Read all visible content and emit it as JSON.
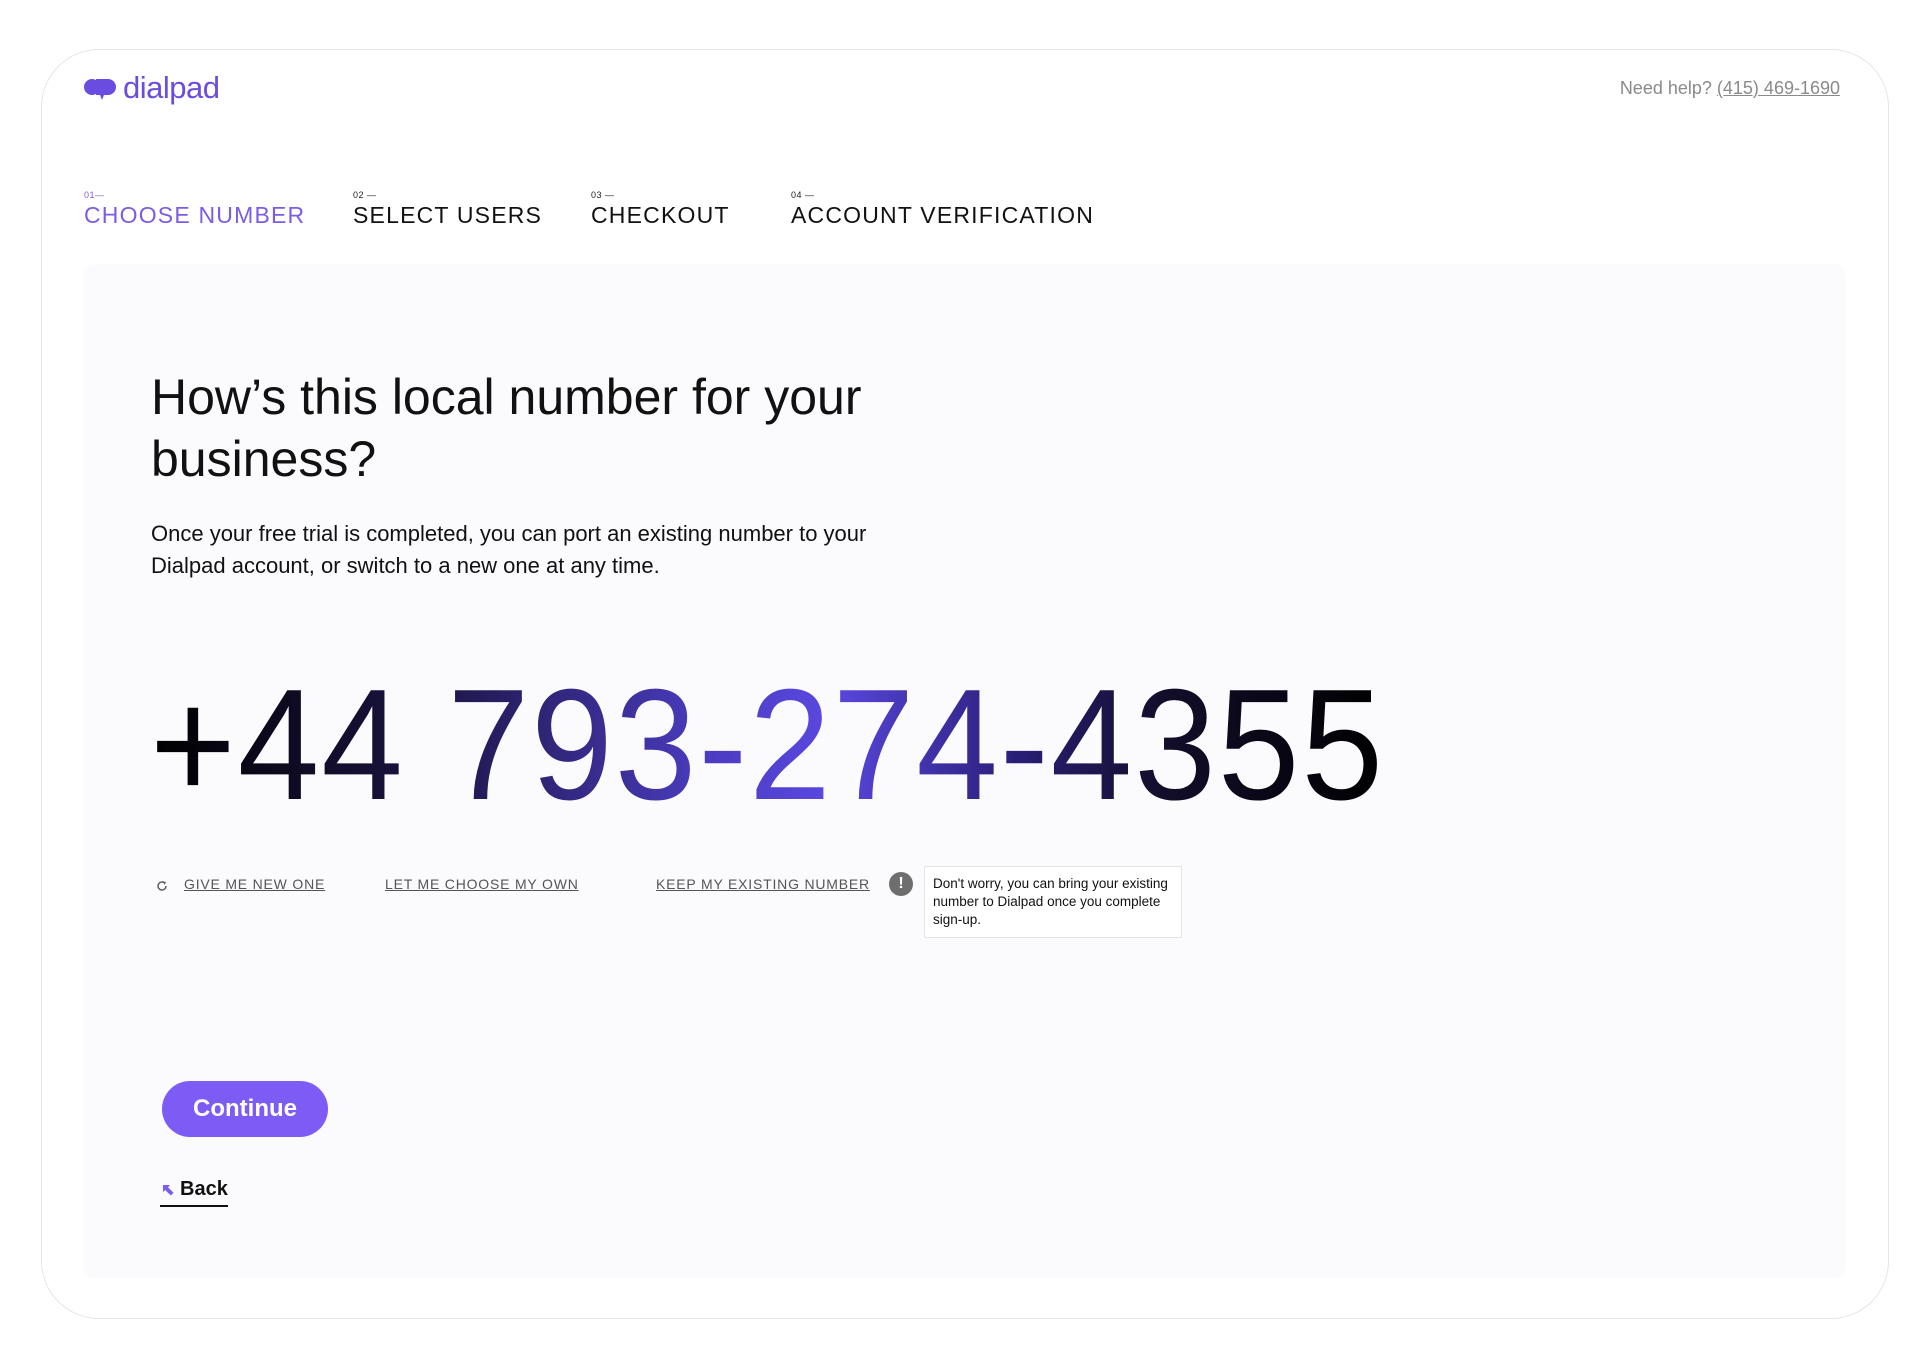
{
  "brand": {
    "name": "dialpad",
    "color": "#6a4ce0"
  },
  "help": {
    "prefix": "Need help?",
    "phone": "(415) 469-1690"
  },
  "steps": [
    {
      "num": "01—",
      "label": "CHOOSE NUMBER",
      "active": true
    },
    {
      "num": "02 —",
      "label": "SELECT USERS",
      "active": false
    },
    {
      "num": "03 —",
      "label": "CHECKOUT",
      "active": false
    },
    {
      "num": "04 —",
      "label": "ACCOUNT VERIFICATION",
      "active": false
    }
  ],
  "main": {
    "headline": "How’s this local number for your business?",
    "subtext": "Once your free trial is completed, you can port an existing number to your Dialpad account, or switch to a new one at any time.",
    "phone_number": "+44 793-274-4355"
  },
  "options": {
    "new_one": "GIVE ME NEW ONE",
    "choose_own": "LET ME CHOOSE MY OWN",
    "keep_existing": "KEEP MY EXISTING NUMBER",
    "info_glyph": "!",
    "tooltip": "Don't worry, you can bring your existing number to Dialpad once you complete sign-up."
  },
  "actions": {
    "continue_label": "Continue",
    "back_label": "Back",
    "accent": "#7c5cf5"
  }
}
